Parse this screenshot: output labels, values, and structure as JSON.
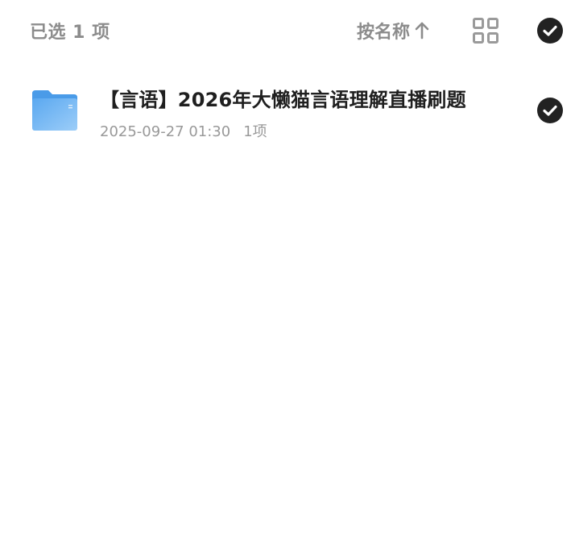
{
  "toolbar": {
    "selected_count": "已选 1 项",
    "sort_label": "按名称",
    "icons": {
      "sort_direction": "arrow-up-icon",
      "view_mode": "grid-view-icon",
      "select_all": "check-circle-icon"
    },
    "colors": {
      "muted_text": "#8c8c8c",
      "check_fill": "#222222"
    }
  },
  "files": [
    {
      "name": "【言语】2026年大懒猫言语理解直播刷题",
      "modified": "2025-09-27 01:30",
      "item_count": "1项",
      "type_icon": "folder-icon",
      "selected": true,
      "folder_color": "#6fb3f2"
    }
  ]
}
